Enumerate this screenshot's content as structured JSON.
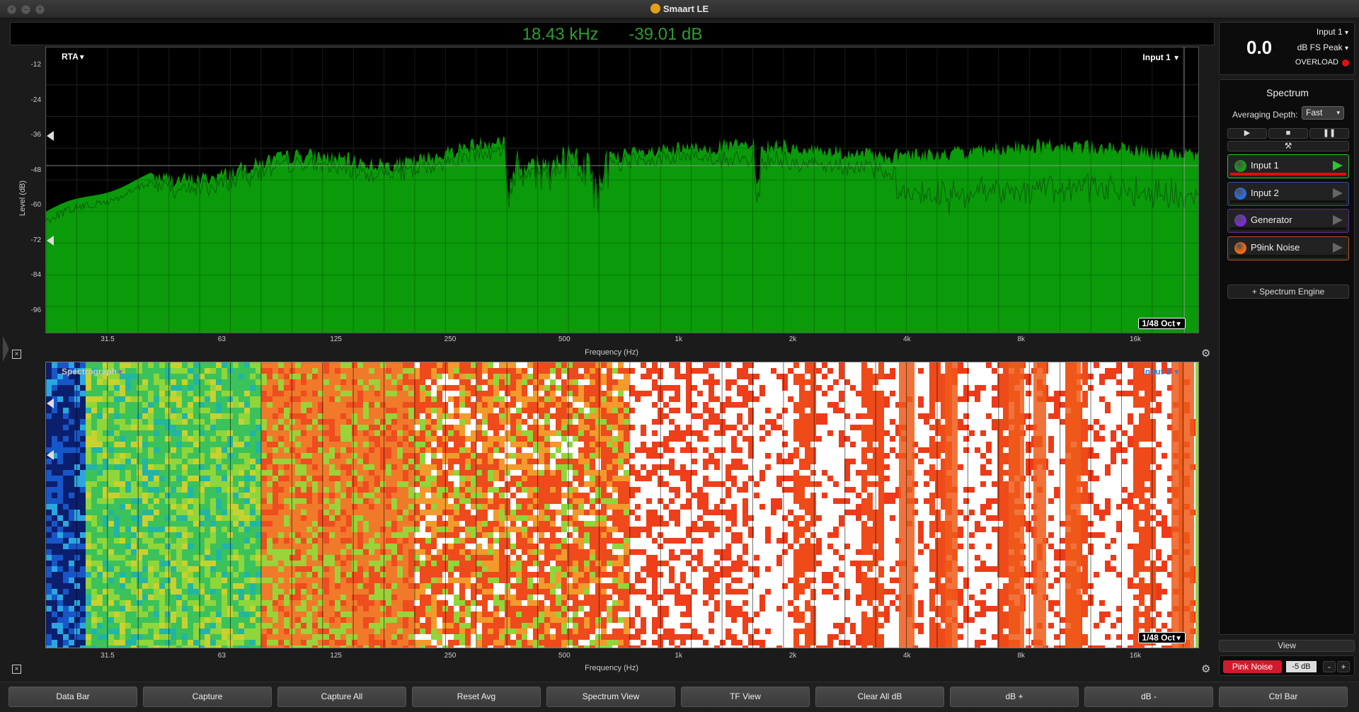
{
  "window": {
    "title": "Smaart LE"
  },
  "data_bar": {
    "frequency": "18.43 kHz",
    "level": "-39.01 dB"
  },
  "rta": {
    "mode_label": "RTA",
    "input_label": "Input 1",
    "y_axis_title": "Level (dB)",
    "y_ticks": [
      "-12",
      "-24",
      "-36",
      "-48",
      "-60",
      "-72",
      "-84",
      "-96"
    ],
    "x_ticks": [
      "31.5",
      "63",
      "125",
      "250",
      "500",
      "1k",
      "2k",
      "4k",
      "8k",
      "16k"
    ],
    "x_axis_title": "Frequency (Hz)",
    "resolution": "1/48 Oct",
    "colors": {
      "fill": "#0a9a0a",
      "trace": "#0b5f0b",
      "background": "#000000"
    }
  },
  "spectrograph": {
    "mode_label": "Spectrograph",
    "input_label": "Input 1",
    "x_ticks": [
      "31.5",
      "63",
      "125",
      "250",
      "500",
      "1k",
      "2k",
      "4k",
      "8k",
      "16k"
    ],
    "x_axis_title": "Frequency (Hz)",
    "resolution": "1/48 Oct"
  },
  "meter": {
    "value": "0.0",
    "input": "Input 1",
    "scale": "dB FS Peak",
    "overload": "OVERLOAD",
    "overload_color": "#e01010"
  },
  "spectrum_panel": {
    "title": "Spectrum",
    "averaging_label": "Averaging Depth:",
    "averaging_value": "Fast",
    "sources": [
      {
        "name": "Input 1",
        "color": "#1a9a1a",
        "border": "#2ec52e",
        "bar": "#e00d0d"
      },
      {
        "name": "Input 2",
        "color": "#2b6de0",
        "border": "#2c4aa5",
        "bar": "#111111"
      },
      {
        "name": "Generator",
        "color": "#7b2bd6",
        "border": "#5a2b9a",
        "bar": "#111111"
      },
      {
        "name": "P9ink Noise",
        "color": "#ee6a14",
        "border": "#b3510f",
        "bar": "#111111"
      }
    ],
    "add_engine": "+ Spectrum Engine",
    "view_label": "View",
    "pink_noise": "Pink Noise",
    "gen_level": "-5 dB",
    "minus": "-",
    "plus": "+"
  },
  "bottom_buttons": [
    "Data Bar",
    "Capture",
    "Capture All",
    "Reset Avg",
    "Spectrum View",
    "TF View",
    "Clear All dB",
    "dB +",
    "dB -",
    "Ctrl Bar"
  ]
}
